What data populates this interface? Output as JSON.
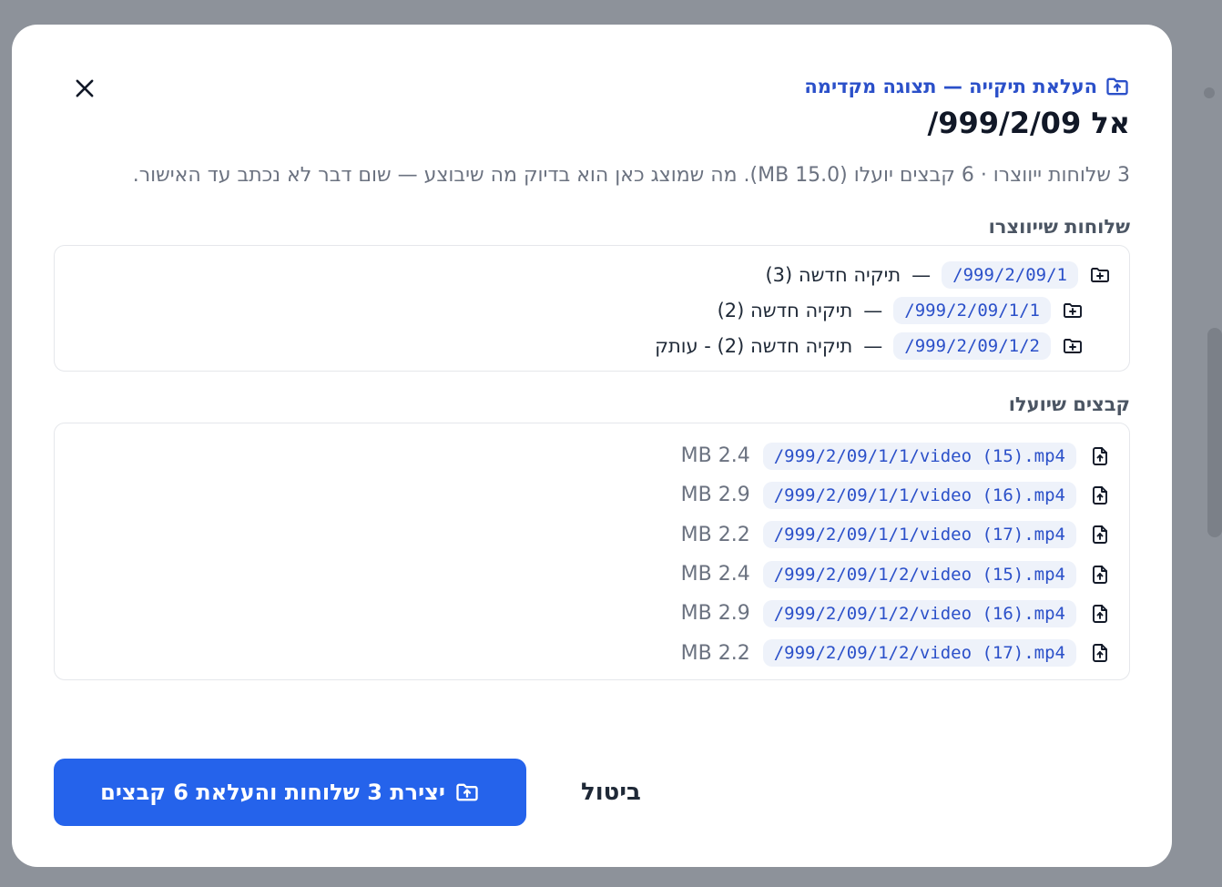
{
  "dialog": {
    "eyebrow": "העלאת תיקייה — תצוגה מקדימה",
    "title": "אל 999/2/09/",
    "description": "3 שלוחות ייווצרו · 6 קבצים יועלו (15.0 MB). מה שמוצג כאן הוא בדיוק מה שיבוצע — שום דבר לא נכתב עד האישור.",
    "close_icon": "close-icon",
    "folders_label": "שלוחות שייווצרו",
    "files_label": "קבצים שיועלו",
    "separator": "—",
    "folders": [
      {
        "path": "/999/2/09/1",
        "name": "תיקיה חדשה (3)",
        "depth": 0
      },
      {
        "path": "/999/2/09/1/1",
        "name": "תיקיה חדשה (2)",
        "depth": 1
      },
      {
        "path": "/999/2/09/1/2",
        "name": "תיקיה חדשה (2) - עותק",
        "depth": 1
      }
    ],
    "files": [
      {
        "path": "/999/2/09/1/1/video (15).mp4",
        "size": "2.4 MB"
      },
      {
        "path": "/999/2/09/1/1/video (16).mp4",
        "size": "2.9 MB"
      },
      {
        "path": "/999/2/09/1/1/video (17).mp4",
        "size": "2.2 MB"
      },
      {
        "path": "/999/2/09/1/2/video (15).mp4",
        "size": "2.4 MB"
      },
      {
        "path": "/999/2/09/1/2/video (16).mp4",
        "size": "2.9 MB"
      },
      {
        "path": "/999/2/09/1/2/video (17).mp4",
        "size": "2.2 MB"
      }
    ],
    "actions": {
      "confirm_label": "יצירת 3 שלוחות והעלאת 6 קבצים",
      "cancel_label": "ביטול"
    },
    "colors": {
      "accent": "#2563eb",
      "link": "#2b50c9",
      "chip_bg": "#eef2fa"
    }
  }
}
